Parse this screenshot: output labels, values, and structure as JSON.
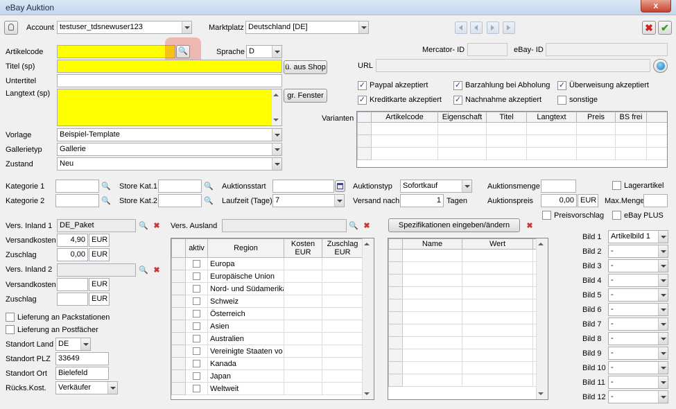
{
  "window": {
    "title": "eBay Auktion",
    "close": "x"
  },
  "toolbar": {
    "account_label": "Account",
    "account_value": "testuser_tdsnewuser123",
    "marktplatz_label": "Marktplatz",
    "marktplatz_value": "Deutschland [DE]"
  },
  "article": {
    "artikelcode_label": "Artikelcode",
    "artikelcode_value": "",
    "sprache_label": "Sprache",
    "sprache_value": "D",
    "titel_label": "Titel (sp)",
    "titel_value": "",
    "aus_shop_button": "ü. aus Shop",
    "untertitel_label": "Untertitel",
    "langtext_label": "Langtext (sp)",
    "gr_fenster_button": "gr. Fenster",
    "vorlage_label": "Vorlage",
    "vorlage_value": "Beispiel-Template",
    "galerietyp_label": "Gallerietyp",
    "galerietyp_value": "Gallerie",
    "zustand_label": "Zustand",
    "zustand_value": "Neu"
  },
  "ids": {
    "mercator_label": "Mercator- ID",
    "ebay_label": "eBay- ID",
    "url_label": "URL"
  },
  "payments": {
    "paypal": "Paypal akzeptiert",
    "barzahlung": "Barzahlung bei Abholung",
    "ueberweisung": "Überweisung akzeptiert",
    "kreditkarte": "Kreditkarte akzeptiert",
    "nachnahme": "Nachnahme akzeptiert",
    "sonstige": "sonstige"
  },
  "varianten": {
    "label": "Varianten",
    "columns": [
      "Artikelcode",
      "Eigenschaft",
      "Titel",
      "Langtext",
      "Preis",
      "BS frei"
    ]
  },
  "auction": {
    "kategorie1_label": "Kategorie 1",
    "kategorie2_label": "Kategorie 2",
    "storekat1_label": "Store Kat.1",
    "storekat2_label": "Store Kat.2",
    "auktionsstart_label": "Auktionsstart",
    "laufzeit_label": "Laufzeit (Tage)",
    "laufzeit_value": "7",
    "auktionstyp_label": "Auktionstyp",
    "auktionstyp_value": "Sofortkauf",
    "versand_nach_label": "Versand nach",
    "versand_nach_value": "1",
    "tagen_label": "Tagen",
    "auktionsmenge_label": "Auktionsmenge",
    "auktionspreis_label": "Auktionspreis",
    "auktionspreis_value": "0,00",
    "eur": "EUR",
    "lagerartikel_label": "Lagerartikel",
    "maxmenge_label": "Max.Menge",
    "preisvorschlag_label": "Preisvorschlag",
    "ebayplus_label": "eBay PLUS"
  },
  "shipping": {
    "inland1_label": "Vers. Inland 1",
    "inland1_value": "DE_Paket",
    "versandkosten_label": "Versandkosten",
    "versandkosten1_value": "4,90",
    "zuschlag_label": "Zuschlag",
    "zuschlag1_value": "0,00",
    "inland2_label": "Vers. Inland 2",
    "eur": "EUR",
    "packstationen_label": "Lieferung an Packstationen",
    "postfaecher_label": "Lieferung an Postfächer",
    "standort_land_label": "Standort Land",
    "standort_land_value": "DE",
    "standort_plz_label": "Standort PLZ",
    "standort_plz_value": "33649",
    "standort_ort_label": "Standort Ort",
    "standort_ort_value": "Bielefeld",
    "rueckskost_label": "Rücks.Kost.",
    "rueckskost_value": "Verkäufer",
    "ausland_label": "Vers. Ausland"
  },
  "regions": {
    "columns": [
      "aktiv",
      "Region",
      "Kosten EUR",
      "Zuschlag EUR"
    ],
    "rows": [
      "Europa",
      "Europäische Union",
      "Nord- und Südamerika",
      "Schweiz",
      "Österreich",
      "Asien",
      "Australien",
      "Vereinigte Staaten vo",
      "Kanada",
      "Japan",
      "Weltweit"
    ]
  },
  "specs": {
    "button": "Spezifikationen eingeben/ändern",
    "columns": [
      "Name",
      "Wert"
    ]
  },
  "images": {
    "labels": [
      "Bild 1",
      "Bild 2",
      "Bild 3",
      "Bild 4",
      "Bild 5",
      "Bild 6",
      "Bild 7",
      "Bild 8",
      "Bild 9",
      "Bild 10",
      "Bild 11",
      "Bild 12"
    ],
    "values": [
      "Artikelbild 1",
      "-",
      "-",
      "-",
      "-",
      "-",
      "-",
      "-",
      "-",
      "-",
      "-",
      "-"
    ]
  }
}
